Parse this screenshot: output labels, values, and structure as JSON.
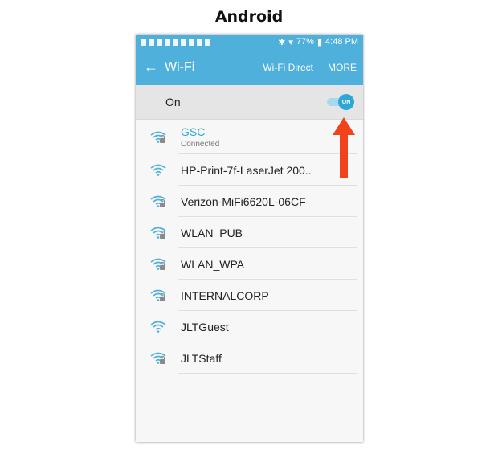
{
  "caption": "Android",
  "status_bar": {
    "battery": "77%",
    "time": "4:48 PM"
  },
  "app_bar": {
    "back_glyph": "←",
    "title": "Wi-Fi",
    "action_direct": "Wi-Fi Direct",
    "action_more": "MORE"
  },
  "toggle_row": {
    "label": "On",
    "switch_text": "ON"
  },
  "networks": [
    {
      "name": "GSC",
      "status": "Connected",
      "locked": true,
      "connected": true
    },
    {
      "name": "HP-Print-7f-LaserJet 200..",
      "status": "",
      "locked": false,
      "connected": false
    },
    {
      "name": "Verizon-MiFi6620L-06CF",
      "status": "",
      "locked": true,
      "connected": false
    },
    {
      "name": "WLAN_PUB",
      "status": "",
      "locked": true,
      "connected": false
    },
    {
      "name": "WLAN_WPA",
      "status": "",
      "locked": true,
      "connected": false
    },
    {
      "name": "INTERNALCORP",
      "status": "",
      "locked": true,
      "connected": false
    },
    {
      "name": "JLTGuest",
      "status": "",
      "locked": false,
      "connected": false
    },
    {
      "name": "JLTStaff",
      "status": "",
      "locked": true,
      "connected": false
    }
  ],
  "colors": {
    "accent": "#4fb0dc",
    "annotation_arrow": "#f2421b"
  }
}
